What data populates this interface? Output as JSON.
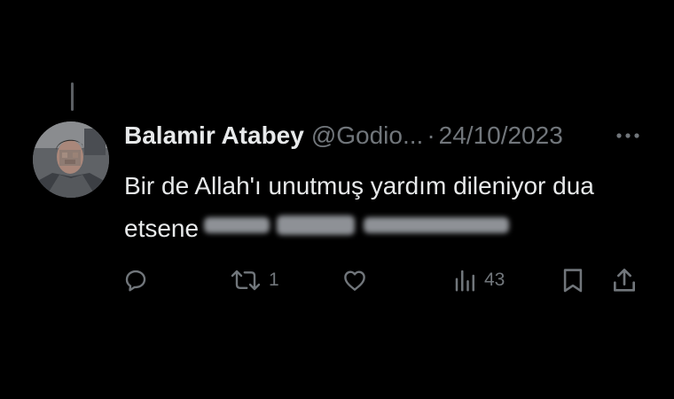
{
  "tweet": {
    "display_name": "Balamir Atabey",
    "handle": "@Godio...",
    "separator": "·",
    "date": "24/10/2023",
    "text": "Bir de Allah'ı unutmuş yardım dileniyor dua etsene"
  },
  "actions": {
    "replies": {
      "icon": "reply-icon",
      "count": ""
    },
    "retweets": {
      "icon": "retweet-icon",
      "count": "1"
    },
    "likes": {
      "icon": "heart-icon",
      "count": ""
    },
    "views": {
      "icon": "analytics-icon",
      "count": "43"
    },
    "bookmark": {
      "icon": "bookmark-icon"
    },
    "share": {
      "icon": "share-icon"
    }
  },
  "colors": {
    "background": "#000000",
    "primary_text": "#e7e9ea",
    "secondary_text": "#71767b",
    "thread_line": "#5b5f63"
  }
}
